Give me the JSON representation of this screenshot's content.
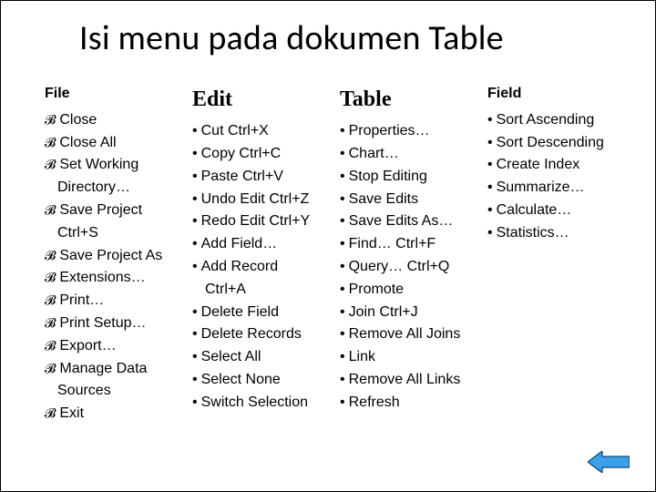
{
  "title": "Isi menu pada dokumen Table",
  "columns": {
    "file": {
      "heading": "File",
      "items": [
        "Close",
        "Close All",
        "Set Working Directory…",
        "Save Project Ctrl+S",
        "Save Project As",
        "Extensions…",
        "Print…",
        "Print Setup…",
        "Export…",
        "Manage Data Sources",
        "Exit"
      ]
    },
    "edit": {
      "heading": "Edit",
      "items": [
        "Cut Ctrl+X",
        "Copy Ctrl+C",
        "Paste Ctrl+V",
        "Undo Edit Ctrl+Z",
        "Redo Edit Ctrl+Y",
        "Add Field…",
        "Add Record Ctrl+A",
        "Delete Field",
        "Delete Records",
        "Select All",
        "Select None",
        "Switch Selection"
      ]
    },
    "table": {
      "heading": "Table",
      "items": [
        "Properties…",
        "Chart…",
        "Stop Editing",
        "Save Edits",
        "Save Edits As…",
        "Find… Ctrl+F",
        "Query… Ctrl+Q",
        "Promote",
        "Join Ctrl+J",
        "Remove All Joins",
        "Link",
        "Remove All Links",
        "Refresh"
      ]
    },
    "field": {
      "heading": "Field",
      "items": [
        "Sort Ascending",
        "Sort Descending",
        "Create Index",
        "Summarize…",
        "Calculate…",
        "Statistics…"
      ]
    }
  },
  "nav": {
    "back_label": "Back"
  }
}
